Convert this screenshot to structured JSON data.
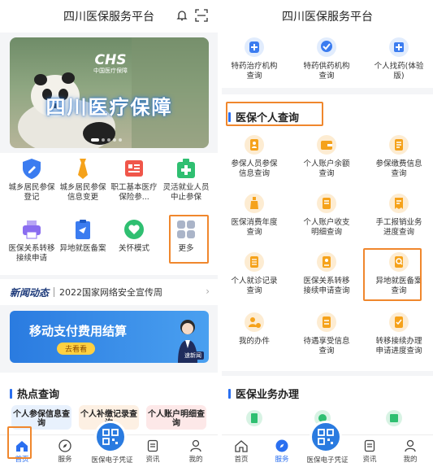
{
  "left": {
    "title": "四川医保服务平台",
    "banner": {
      "logo_main": "CHS",
      "logo_sub": "中国医疗保障",
      "main_text": "四川医疗保障"
    },
    "grid": [
      {
        "label": "城乡居民参保登记",
        "icon": "shield-pen-icon",
        "color": "#3b7cf0"
      },
      {
        "label": "城乡居民参保信息变更",
        "icon": "tie-icon",
        "color": "#f5a21b"
      },
      {
        "label": "职工基本医疗保险参...",
        "icon": "document-list-icon",
        "color": "#f0564a"
      },
      {
        "label": "灵活就业人员中止参保",
        "icon": "medical-kit-icon",
        "color": "#2fbf71"
      },
      {
        "label": "医保关系转移接续申请",
        "icon": "printer-icon",
        "color": "#8a6df0"
      },
      {
        "label": "异地就医备案",
        "icon": "clipboard-icon",
        "color": "#3b7cf0"
      },
      {
        "label": "关怀模式",
        "icon": "heart-hand-icon",
        "color": "#2fbf71"
      },
      {
        "label": "更多",
        "icon": "more-grid-icon",
        "color": "#aab4c8"
      }
    ],
    "news": {
      "tag": "新闻动态",
      "text": "2022国家网络安全宣传周"
    },
    "promo": {
      "text": "移动支付费用结算",
      "button": "去看看",
      "badge": "速新闻"
    },
    "hot_section": {
      "title": "热点查询"
    },
    "hot_cards": [
      {
        "text": "个人参保信息查询",
        "bg": "#e8f1fd"
      },
      {
        "text": "个人补缴记录查询",
        "bg": "#fdf0e3"
      },
      {
        "text": "个人账户明细查询",
        "bg": "#fde8e8"
      }
    ],
    "tabbar": {
      "home": "首页",
      "service": "服务",
      "ecert": "医保电子凭证",
      "news": "资讯",
      "mine": "我的"
    }
  },
  "right": {
    "title": "四川医保服务平台",
    "top_items": [
      {
        "label": "特药治疗机构查询",
        "icon": "hospital-icon",
        "color": "#3b7cf0"
      },
      {
        "label": "特药供药机构查询",
        "icon": "pharmacy-icon",
        "color": "#3b7cf0"
      },
      {
        "label": "个人找药(体验版)",
        "icon": "medicine-box-icon",
        "color": "#3b7cf0"
      }
    ],
    "personal_section": {
      "title": "医保个人查询"
    },
    "personal_items": [
      {
        "label": "参保人员参保信息查询",
        "icon": "person-doc-icon"
      },
      {
        "label": "个人账户余额查询",
        "icon": "wallet-icon"
      },
      {
        "label": "参保缴费信息查询",
        "icon": "payment-doc-icon"
      },
      {
        "label": "医保消费年度查询",
        "icon": "bottle-icon"
      },
      {
        "label": "个人账户收支明细查询",
        "icon": "ledger-icon"
      },
      {
        "label": "手工报销业务进度查询",
        "icon": "receipt-icon"
      },
      {
        "label": "个人就诊记录查询",
        "icon": "record-icon"
      },
      {
        "label": "医保关系转移接续申请查询",
        "icon": "transfer-icon"
      },
      {
        "label": "异地就医备案查询",
        "icon": "search-doc-icon"
      },
      {
        "label": "我的办件",
        "icon": "person-task-icon"
      },
      {
        "label": "待遇享受信息查询",
        "icon": "benefit-icon"
      },
      {
        "label": "转移接续办理申请进度查询",
        "icon": "progress-icon"
      }
    ],
    "business_section": {
      "title": "医保业务办理"
    },
    "tabbar": {
      "home": "首页",
      "service": "服务",
      "ecert": "医保电子凭证",
      "news": "资讯",
      "mine": "我的"
    }
  },
  "colors": {
    "accent": "#2a6ff0",
    "highlight": "#f0872d",
    "icon_orange": "#f5a21b"
  }
}
